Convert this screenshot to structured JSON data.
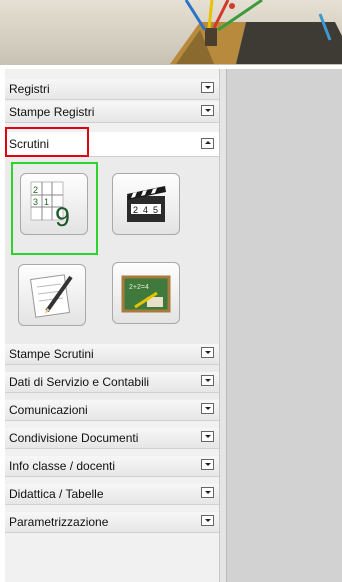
{
  "sidebar": {
    "sections": [
      {
        "label": "Registri",
        "state": "collapsed"
      },
      {
        "label": "Stampe Registri",
        "state": "collapsed"
      },
      {
        "label": "Scrutini",
        "state": "expanded"
      },
      {
        "label": "Stampe Scrutini",
        "state": "collapsed"
      },
      {
        "label": "Dati di Servizio e Contabili",
        "state": "collapsed"
      },
      {
        "label": "Comunicazioni",
        "state": "collapsed"
      },
      {
        "label": "Condivisione Documenti",
        "state": "collapsed"
      },
      {
        "label": "Info classe / docenti",
        "state": "collapsed"
      },
      {
        "label": "Didattica / Tabelle",
        "state": "collapsed"
      },
      {
        "label": "Parametrizzazione",
        "state": "collapsed"
      }
    ],
    "scrutini_icons": [
      {
        "name": "grades-grid-icon",
        "cells": [
          "2",
          "",
          "3",
          "1"
        ],
        "big": "9"
      },
      {
        "name": "clapperboard-icon",
        "cells": [
          "2",
          "4",
          "5"
        ]
      },
      {
        "name": "notepad-pencil-icon"
      },
      {
        "name": "chalkboard-icon",
        "text": "2+2=4"
      }
    ]
  },
  "highlights": {
    "red_box": "#e3000f",
    "green_box": "#2ed42e"
  }
}
